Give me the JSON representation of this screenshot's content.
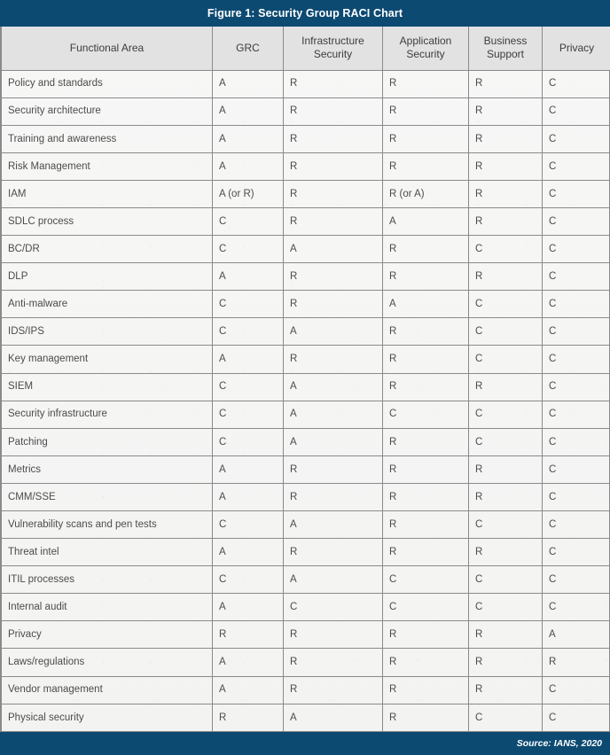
{
  "figure": {
    "title": "Figure 1: Security Group RACI Chart",
    "source": "Source: IANS, 2020",
    "accent_color": "#0d4a72",
    "header_bg_color": "#e2e2e2",
    "border_color": "#8a8a8a",
    "text_color": "#4c4c4c"
  },
  "table": {
    "columns": [
      {
        "label": "Functional Area",
        "lines": [
          "Functional Area"
        ]
      },
      {
        "label": "GRC",
        "lines": [
          "GRC"
        ]
      },
      {
        "label": "Infrastructure Security",
        "lines": [
          "Infrastructure",
          "Security"
        ]
      },
      {
        "label": "Application Security",
        "lines": [
          "Application",
          "Security"
        ]
      },
      {
        "label": "Business Support",
        "lines": [
          "Business",
          "Support"
        ]
      },
      {
        "label": "Privacy",
        "lines": [
          "Privacy"
        ]
      }
    ],
    "rows": [
      {
        "area": "Policy and standards",
        "grc": "A",
        "infra": "R",
        "app": "R",
        "biz": "R",
        "priv": "C"
      },
      {
        "area": "Security architecture",
        "grc": "A",
        "infra": "R",
        "app": "R",
        "biz": "R",
        "priv": "C"
      },
      {
        "area": "Training and awareness",
        "grc": "A",
        "infra": "R",
        "app": "R",
        "biz": "R",
        "priv": "C"
      },
      {
        "area": "Risk Management",
        "grc": "A",
        "infra": "R",
        "app": "R",
        "biz": "R",
        "priv": "C"
      },
      {
        "area": "IAM",
        "grc": "A (or R)",
        "infra": "R",
        "app": "R (or A)",
        "biz": "R",
        "priv": "C"
      },
      {
        "area": "SDLC process",
        "grc": "C",
        "infra": "R",
        "app": "A",
        "biz": "R",
        "priv": "C"
      },
      {
        "area": "BC/DR",
        "grc": "C",
        "infra": "A",
        "app": "R",
        "biz": "C",
        "priv": "C"
      },
      {
        "area": "DLP",
        "grc": "A",
        "infra": "R",
        "app": "R",
        "biz": "R",
        "priv": "C"
      },
      {
        "area": "Anti-malware",
        "grc": "C",
        "infra": "R",
        "app": "A",
        "biz": "C",
        "priv": "C"
      },
      {
        "area": "IDS/IPS",
        "grc": "C",
        "infra": "A",
        "app": "R",
        "biz": "C",
        "priv": "C"
      },
      {
        "area": "Key management",
        "grc": "A",
        "infra": "R",
        "app": "R",
        "biz": "C",
        "priv": "C"
      },
      {
        "area": "SIEM",
        "grc": "C",
        "infra": "A",
        "app": "R",
        "biz": "R",
        "priv": "C"
      },
      {
        "area": "Security infrastructure",
        "grc": "C",
        "infra": "A",
        "app": "C",
        "biz": "C",
        "priv": "C"
      },
      {
        "area": "Patching",
        "grc": "C",
        "infra": "A",
        "app": "R",
        "biz": "C",
        "priv": "C"
      },
      {
        "area": "Metrics",
        "grc": "A",
        "infra": "R",
        "app": "R",
        "biz": "R",
        "priv": "C"
      },
      {
        "area": "CMM/SSE",
        "grc": "A",
        "infra": "R",
        "app": "R",
        "biz": "R",
        "priv": "C"
      },
      {
        "area": "Vulnerability scans and pen tests",
        "grc": "C",
        "infra": "A",
        "app": "R",
        "biz": "C",
        "priv": "C"
      },
      {
        "area": "Threat intel",
        "grc": "A",
        "infra": "R",
        "app": "R",
        "biz": "R",
        "priv": "C"
      },
      {
        "area": "ITIL processes",
        "grc": "C",
        "infra": "A",
        "app": "C",
        "biz": "C",
        "priv": "C"
      },
      {
        "area": "Internal audit",
        "grc": "A",
        "infra": "C",
        "app": "C",
        "biz": "C",
        "priv": "C"
      },
      {
        "area": "Privacy",
        "grc": "R",
        "infra": "R",
        "app": "R",
        "biz": "R",
        "priv": "A"
      },
      {
        "area": "Laws/regulations",
        "grc": "A",
        "infra": "R",
        "app": "R",
        "biz": "R",
        "priv": "R"
      },
      {
        "area": "Vendor management",
        "grc": "A",
        "infra": "R",
        "app": "R",
        "biz": "R",
        "priv": "C"
      },
      {
        "area": "Physical security",
        "grc": "R",
        "infra": "A",
        "app": "R",
        "biz": "C",
        "priv": "C"
      }
    ]
  }
}
